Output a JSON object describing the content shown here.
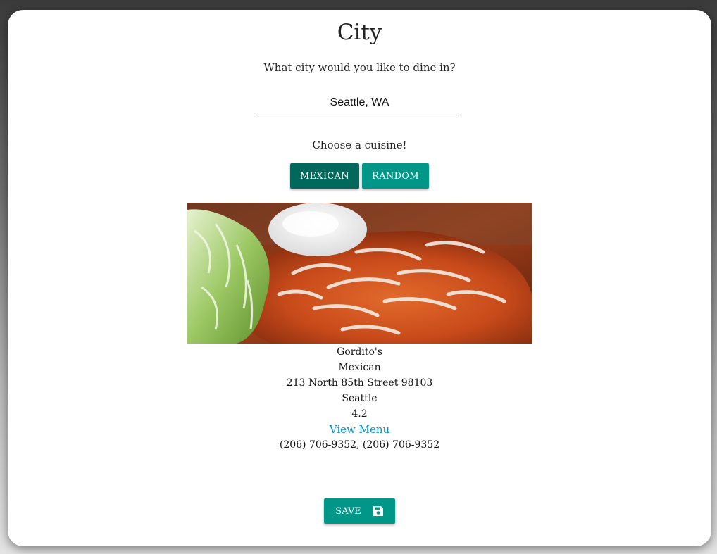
{
  "page": {
    "title": "City",
    "question": "What city would you like to dine in?",
    "city_value": "Seattle, WA",
    "cuisine_prompt": "Choose a cuisine!"
  },
  "cuisine_buttons": {
    "mexican_label": "MEXICAN",
    "random_label": "RANDOM"
  },
  "restaurant": {
    "name": "Gordito's",
    "cuisine": "Mexican",
    "address": "213 North 85th Street 98103",
    "city": "Seattle",
    "rating": "4.2",
    "menu_link": "View Menu",
    "phone": "(206) 706-9352, (206) 706-9352"
  },
  "actions": {
    "save_label": "SAVE",
    "save_icon": "floppy-disk-icon"
  },
  "colors": {
    "accent": "#009688",
    "accent_dark": "#00695c",
    "link": "#0b8fc9"
  }
}
